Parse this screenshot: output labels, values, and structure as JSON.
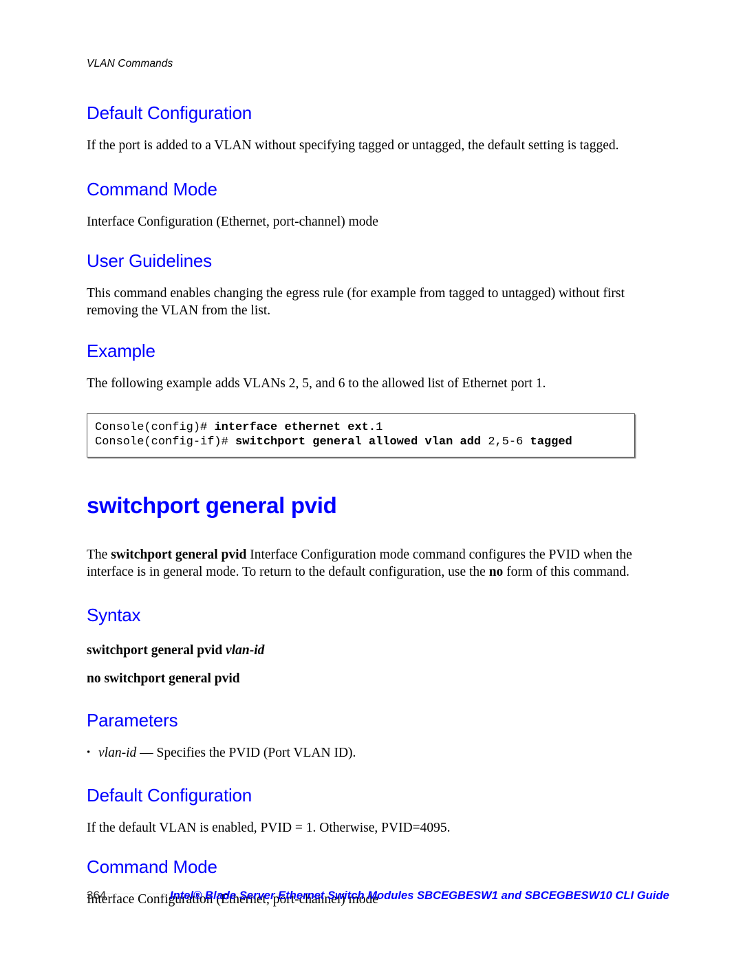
{
  "document": {
    "running_header": "VLAN Commands",
    "page_number": "364",
    "footer_title": "Intel® Blade Server Ethernet Switch Modules SBCEGBESW1 and SBCEGBESW10 CLI Guide",
    "heading_color": "#0000ff",
    "body_color": "#000000"
  },
  "sections": {
    "default_configuration_1": {
      "heading": "Default Configuration",
      "body": "If the port is added to a VLAN without specifying tagged or untagged, the default setting is tagged."
    },
    "command_mode_1": {
      "heading": "Command Mode",
      "body": "Interface Configuration (Ethernet, port-channel) mode"
    },
    "user_guidelines": {
      "heading": "User Guidelines",
      "body": "This command enables changing the egress rule (for example from tagged to untagged) without first removing the VLAN from the list."
    },
    "example": {
      "heading": "Example",
      "body": "The following example adds VLANs 2, 5, and 6 to the allowed list of Ethernet port 1.",
      "console": {
        "line1": {
          "prompt": "Console(config)# ",
          "bold_command": "interface ethernet ext.",
          "plain_tail": "1"
        },
        "line2": {
          "prompt": "Console(config-if)# ",
          "bold_command": "switchport general allowed vlan add ",
          "plain_arg": "2,5-6",
          "bold_tail": " tagged"
        }
      }
    },
    "command_title": "switchport general pvid",
    "command_intro": {
      "lead": "The ",
      "bold_name": "switchport general pvid",
      "mid": " Interface Configuration mode command configures the PVID when the interface is in general mode. To return to the default configuration, use the ",
      "bold_no": "no",
      "tail": " form of this command."
    },
    "syntax": {
      "heading": "Syntax",
      "line1_bold": "switchport general pvid ",
      "line1_italic": "vlan-id",
      "line2_bold": "no switchport general pvid"
    },
    "parameters": {
      "heading": "Parameters",
      "items": [
        {
          "term": "vlan-id",
          "separator": " — ",
          "definition": "Specifies the PVID (Port VLAN ID)."
        }
      ]
    },
    "default_configuration_2": {
      "heading": "Default Configuration",
      "body": "If the default VLAN is enabled, PVID = 1. Otherwise, PVID=4095."
    },
    "command_mode_2": {
      "heading": "Command Mode",
      "body": "Interface Configuration (Ethernet, port-channel) mode"
    }
  }
}
